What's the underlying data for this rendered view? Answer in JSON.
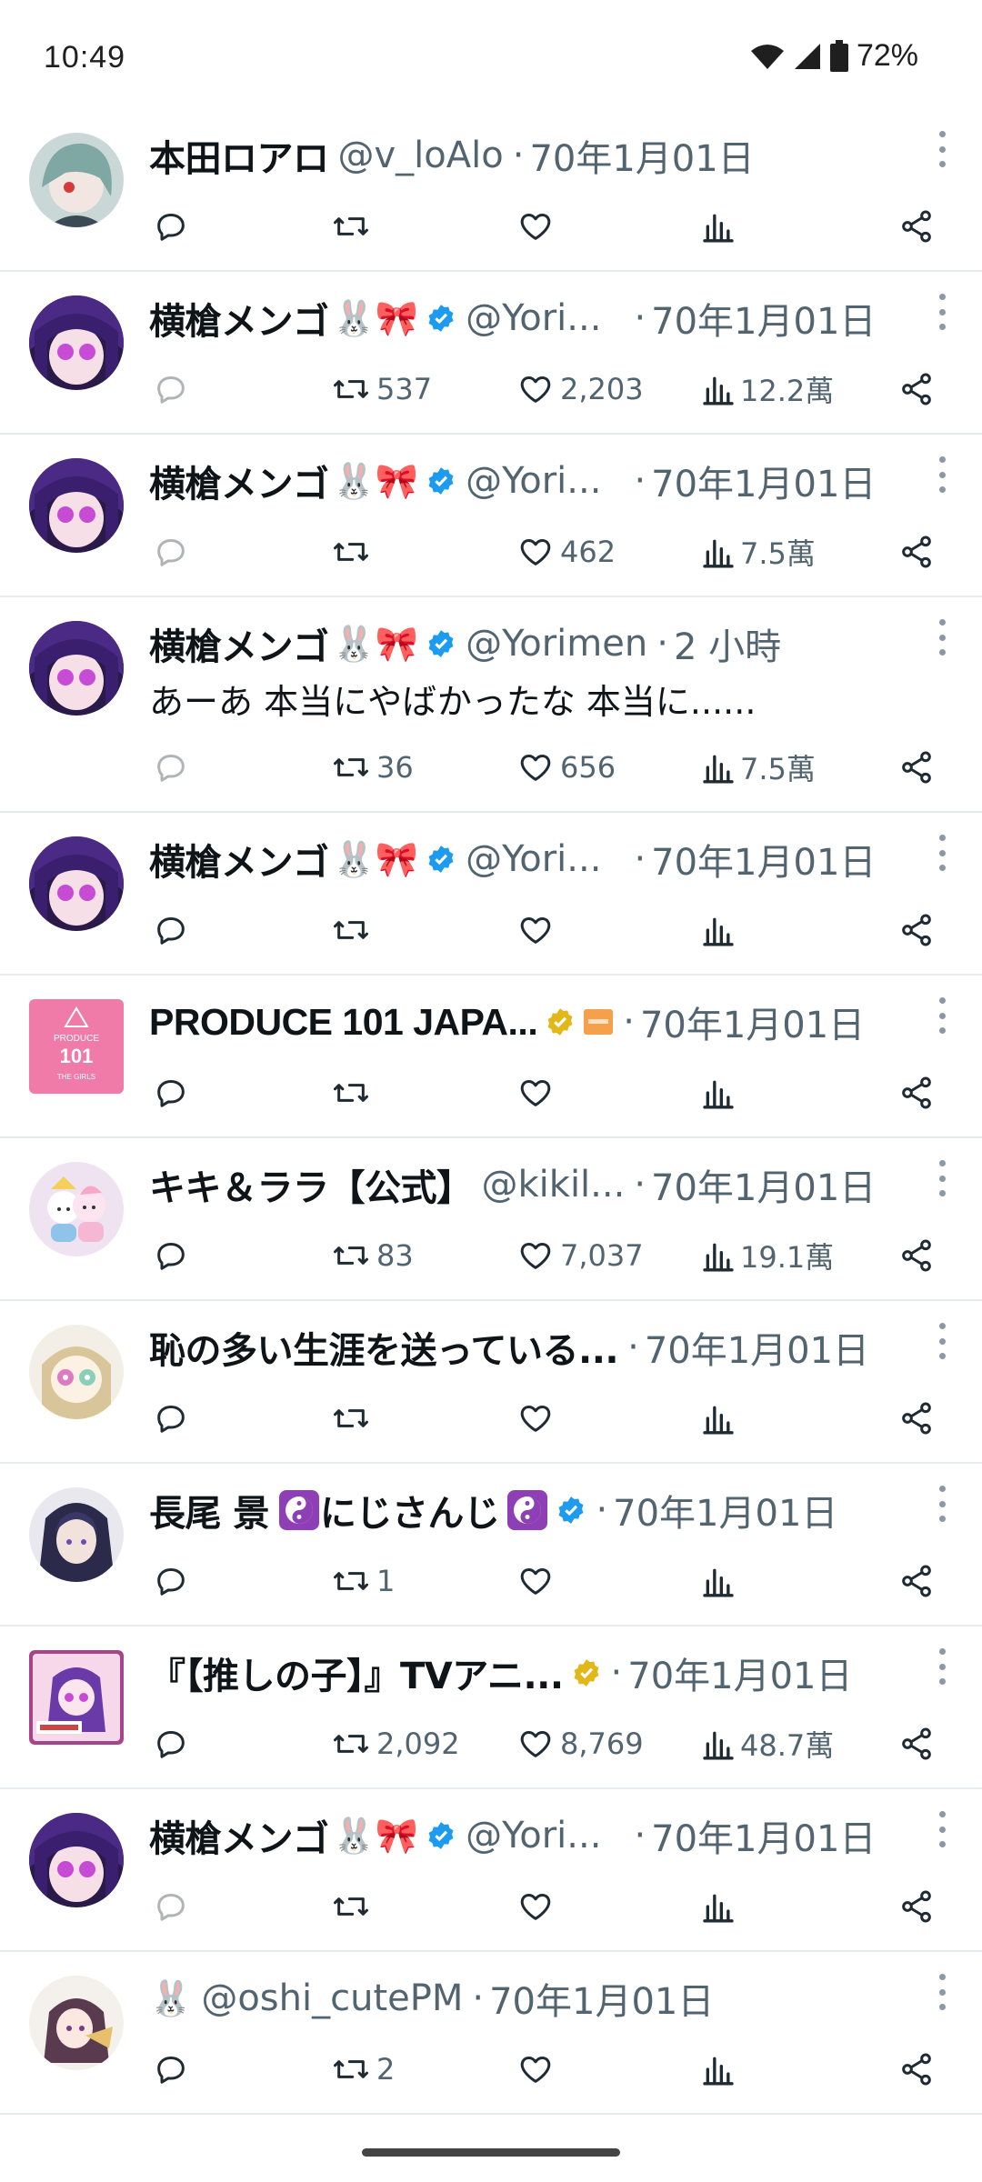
{
  "status": {
    "time": "10:49",
    "battery": "72%"
  },
  "posts": [
    {
      "name": "本田ロアロ",
      "handle": "@v_loAlo",
      "time": "70年1月01日",
      "replies": "",
      "retweets": "",
      "likes": "",
      "views": ""
    },
    {
      "name": "横槍メンゴ",
      "emojis": "🐰🎀",
      "handle": "@Yori...",
      "time": "70年1月01日",
      "retweets": "537",
      "likes": "2,203",
      "views": "12.2萬"
    },
    {
      "name": "横槍メンゴ",
      "emojis": "🐰🎀",
      "handle": "@Yori...",
      "time": "70年1月01日",
      "retweets": "",
      "likes": "462",
      "views": "7.5萬"
    },
    {
      "name": "横槍メンゴ",
      "emojis": "🐰🎀",
      "handle": "@Yorimen",
      "time": "2 小時",
      "text": "あーあ 本当にやばかったな 本当に......",
      "retweets": "36",
      "likes": "656",
      "views": "7.5萬"
    },
    {
      "name": "横槍メンゴ",
      "emojis": "🐰🎀",
      "handle": "@Yori...",
      "time": "70年1月01日",
      "retweets": "",
      "likes": "",
      "views": ""
    },
    {
      "name": "PRODUCE 101 JAPA...",
      "handle": "",
      "time": "70年1月01日",
      "retweets": "",
      "likes": "",
      "views": ""
    },
    {
      "name": "キキ＆ララ【公式】",
      "handle": "@kikil...",
      "time": "70年1月01日",
      "retweets": "83",
      "likes": "7,037",
      "views": "19.1萬"
    },
    {
      "name": "恥の多い生涯を送っている...",
      "handle": "",
      "time": "70年1月01日",
      "retweets": "",
      "likes": "",
      "views": ""
    },
    {
      "name": "長尾 景",
      "name_mid": "にじさんじ",
      "handle": "",
      "time": "70年1月01日",
      "retweets": "1",
      "likes": "",
      "views": ""
    },
    {
      "name": "『【推しの子】』TVアニ...",
      "handle": "",
      "time": "70年1月01日",
      "retweets": "2,092",
      "likes": "8,769",
      "views": "48.7萬"
    },
    {
      "name": "横槍メンゴ",
      "emojis": "🐰🎀",
      "handle": "@Yori...",
      "time": "70年1月01日",
      "retweets": "",
      "likes": "",
      "views": ""
    },
    {
      "name": "",
      "emojis": "🐰",
      "handle": "@oshi_cutePM",
      "time": "70年1月01日",
      "retweets": "2",
      "likes": "",
      "views": ""
    }
  ],
  "produce_logo_text": "PRODUCE 101 JAPAN THE GIRLS",
  "colors": {
    "verified_blue": "#1d9bf0",
    "verified_gold": "#e2b719",
    "text_secondary": "#536471",
    "divider": "#e8ebed"
  },
  "icons": {
    "reply": "reply-icon",
    "retweet": "retweet-icon",
    "like": "heart-icon",
    "views": "views-icon",
    "share": "share-icon",
    "more": "more-icon"
  }
}
